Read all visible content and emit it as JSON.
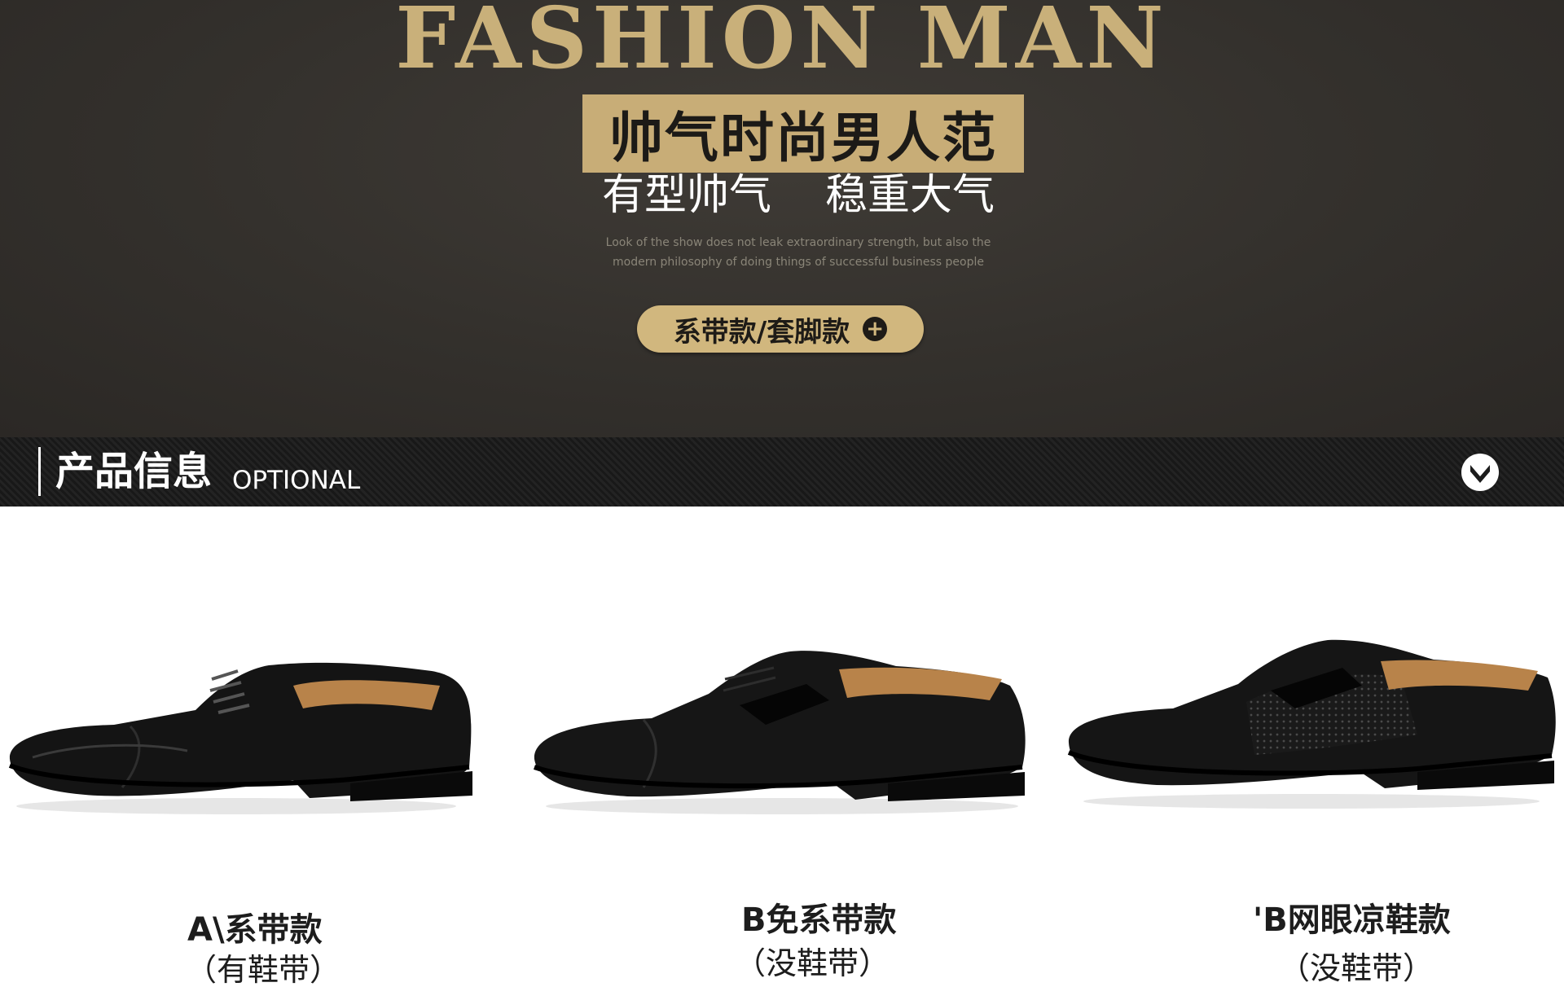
{
  "banner": {
    "title": "FASHION MAN",
    "headline": "帅气时尚男人范",
    "slogan": "有型帅气    稳重大气",
    "description_line1": "Look of the show does not leak extraordinary strength, but also the",
    "description_line2": "modern philosophy of doing things of successful business people",
    "style_button_label": "系带款/套脚款",
    "style_button_icon": "plus-icon"
  },
  "section": {
    "title": "产品信息",
    "subtitle": "OPTIONAL",
    "toggle_icon": "chevron-down-icon"
  },
  "products": [
    {
      "label": "A\\系带款",
      "sublabel": "（有鞋带）"
    },
    {
      "label": "B免系带款",
      "sublabel": "（没鞋带）"
    },
    {
      "label": "'B网眼凉鞋款",
      "sublabel": "（没鞋带）"
    }
  ],
  "colors": {
    "banner_bg": "#33302c",
    "gold": "#c9b07a",
    "bar_bg": "#1c1c1c",
    "shoe": "#141414"
  }
}
